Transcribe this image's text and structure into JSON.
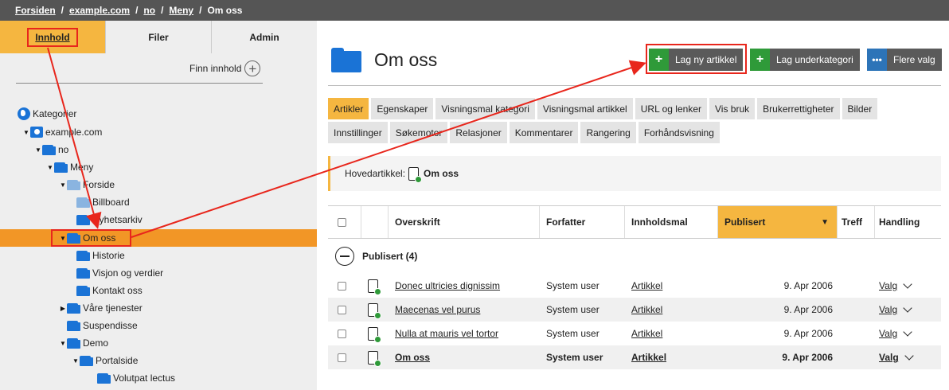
{
  "breadcrumb": [
    "Forsiden",
    "example.com",
    "no",
    "Meny",
    "Om oss"
  ],
  "left_tabs": [
    {
      "label": "Innhold",
      "active": true
    },
    {
      "label": "Filer",
      "active": false
    },
    {
      "label": "Admin",
      "active": false
    }
  ],
  "find_content": "Finn innhold",
  "tree": {
    "root": "Kategorier",
    "site": "example.com",
    "items": [
      "no",
      "Meny",
      "Forside",
      "Billboard",
      "Nyhetsarkiv",
      "Om oss",
      "Historie",
      "Visjon og verdier",
      "Kontakt oss",
      "Våre tjenester",
      "Suspendisse",
      "Demo",
      "Portalside",
      "Volutpat lectus"
    ]
  },
  "page_title": "Om oss",
  "buttons": {
    "new_article": "Lag ny artikkel",
    "new_subcategory": "Lag underkategori",
    "more": "Flere valg"
  },
  "tabs_row1": [
    "Artikler",
    "Egenskaper",
    "Visningsmal kategori",
    "Visningsmal artikkel",
    "URL og lenker",
    "Vis bruk",
    "Brukerrettigheter",
    "Bilder"
  ],
  "tabs_row2": [
    "Innstillinger",
    "Søkemotor",
    "Relasjoner",
    "Kommentarer",
    "Rangering",
    "Forhåndsvisning"
  ],
  "main_article": {
    "label": "Hovedartikkel:",
    "title": "Om oss"
  },
  "table": {
    "headers": [
      "Overskrift",
      "Forfatter",
      "Innholdsmal",
      "Publisert",
      "Treff",
      "Handling"
    ],
    "group": "Publisert (4)",
    "rows": [
      {
        "title": "Donec ultricies dignissim",
        "author": "System user",
        "template": "Artikkel",
        "date": "9. Apr 2006",
        "action": "Valg"
      },
      {
        "title": "Maecenas vel purus",
        "author": "System user",
        "template": "Artikkel",
        "date": "9. Apr 2006",
        "action": "Valg"
      },
      {
        "title": "Nulla at mauris vel tortor",
        "author": "System user",
        "template": "Artikkel",
        "date": "9. Apr 2006",
        "action": "Valg"
      },
      {
        "title": "Om oss",
        "author": "System user",
        "template": "Artikkel",
        "date": "9. Apr 2006",
        "action": "Valg"
      }
    ]
  },
  "colors": {
    "accent": "#f5b640",
    "selected": "#f29626",
    "annotation": "#e8261c",
    "folder": "#1a73d6"
  }
}
